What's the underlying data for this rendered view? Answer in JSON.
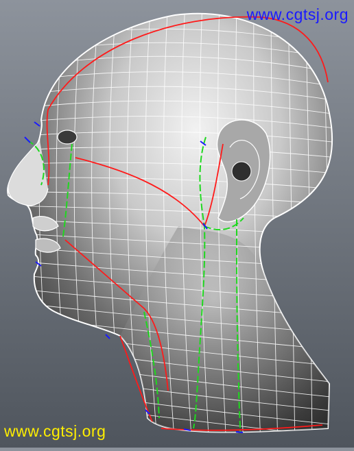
{
  "watermarks": {
    "top": {
      "text": "www.cgtsj.org",
      "color": "#1a1aff"
    },
    "bottom": {
      "text": "www.cgtsj.org",
      "color": "#ffee00"
    }
  },
  "viewport": {
    "background_top": "#8d939c",
    "background_bottom": "#4f555d"
  },
  "model": {
    "shading_colors": [
      "#ffffff",
      "#d9d9d9",
      "#5a5a5a",
      "#2a2a2a"
    ],
    "wire_color": "#ffffff",
    "seam_colors": {
      "red": "#ff1a1a",
      "green": "#1fd81f",
      "blue": "#1a1aff"
    }
  }
}
